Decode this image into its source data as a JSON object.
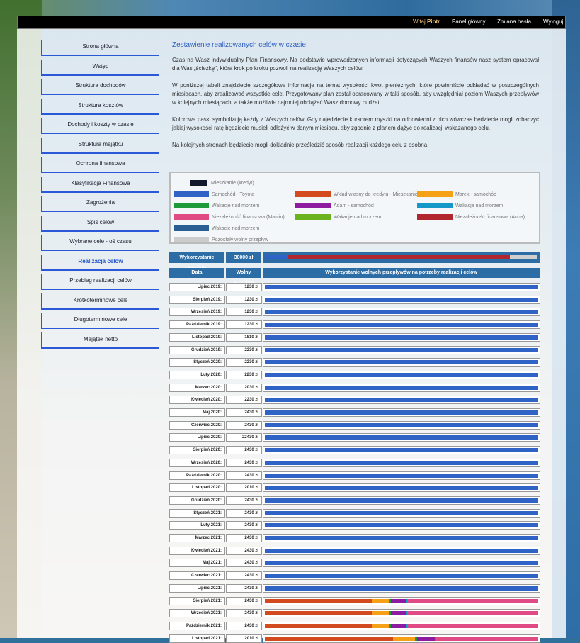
{
  "topbar": {
    "greeting_prefix": "Witaj",
    "user": "Piotr",
    "dashboard": "Panel główny",
    "change_password": "Zmiana hasła",
    "logout": "Wyloguj"
  },
  "sidebar": {
    "items": [
      {
        "label": "Strona główna",
        "active": false
      },
      {
        "label": "Wstęp",
        "active": false
      },
      {
        "label": "Struktura dochodów",
        "active": false
      },
      {
        "label": "Struktura kosztów",
        "active": false
      },
      {
        "label": "Dochody i koszty w czasie",
        "active": false
      },
      {
        "label": "Struktura majątku",
        "active": false
      },
      {
        "label": "Ochrona finansowa",
        "active": false
      },
      {
        "label": "Klasyfikacja Finansowa",
        "active": false
      },
      {
        "label": "Zagrożenia",
        "active": false
      },
      {
        "label": "Spis celów",
        "active": false
      },
      {
        "label": "Wybrane cele - oś czasu",
        "active": false
      },
      {
        "label": "Realizacja celów",
        "active": true
      },
      {
        "label": "Przebieg realizacji celów",
        "active": false
      },
      {
        "label": "Krótkoterminowe cele",
        "active": false
      },
      {
        "label": "Długoterminowe cele",
        "active": false
      },
      {
        "label": "Majątek netto",
        "active": false
      }
    ]
  },
  "main": {
    "heading": "Zestawienie realizowanych celów w czasie:",
    "paragraphs": [
      "Czas na Wasz indywidualny Plan Finansowy. Na podstawie wprowadzonych informacji dotyczących Waszych finansów nasz system opracował dla Was „ścieżkę\", która krok po kroku pozwoli na realizację Waszych celów.",
      "W poniższej tabeli znajdziecie szczegółowe informacje na temat wysokości kwot pieniężnych, które powinniście odkładać w poszczególnych miesiącach, aby zrealizować wszystkie cele. Przygotowany plan został opracowany w taki sposób, aby uwzględniał poziom Waszych przepływów w kolejnych miesiącach, a także możliwie najmniej obciążać Wasz domowy budżet.",
      "Kolorowe paski symbolizują każdy z Waszych celów. Gdy najedziecie kursorem myszki na odpowiedni z nich wówczas będziecie mogli zobaczyć jakiej wysokości ratę będziecie musieli odłożyć w danym miesiącu, aby zgodnie z planem dążyć do realizacji wskazanego celu.",
      "Na kolejnych stronach będziecie mogli dokładnie prześledzić sposób realizacji każdego celu z osobna."
    ]
  },
  "legend": [
    {
      "label": "Mieszkanie (kredyt)",
      "color": "#111a2a"
    },
    {
      "label": "Samochód - Toyota",
      "color": "#2f63c6"
    },
    {
      "label": "Wkład własny do kredytu - Mieszkanie",
      "color": "#d24a1e"
    },
    {
      "label": "Marek - samochód",
      "color": "#f5a015"
    },
    {
      "label": "Wakacje nad morzem",
      "color": "#1f9a3a"
    },
    {
      "label": "Adam - samochód",
      "color": "#8e1aa0"
    },
    {
      "label": "Wakacje nad morzem",
      "color": "#1598c8"
    },
    {
      "label": "Niezależność finansowa (Marcin)",
      "color": "#e04b86"
    },
    {
      "label": "Wakacje nad morzem",
      "color": "#6ab21e"
    },
    {
      "label": "Niezależność finansowa (Anna)",
      "color": "#b1252e"
    },
    {
      "label": "Wakacje nad morzem",
      "color": "#2b5e92"
    },
    {
      "label": "Pozostały wolny przepływ",
      "color": "#cccccc"
    }
  ],
  "deposit": {
    "label": "Wykorzystanie depozytu",
    "value": "30000 zł",
    "segments": [
      {
        "color": "#2f63c6",
        "share": 0.08
      },
      {
        "color": "#b1252e",
        "share": 0.82
      },
      {
        "color": "#cfcfcf",
        "share": 0.1
      }
    ]
  },
  "table": {
    "col_date": "Data",
    "col_free": "Wolny przepływ",
    "col_usage": "Wykorzystanie wolnych przepływów na potrzeby realizacji celów",
    "rows": [
      {
        "date": "Lipiec 2019:",
        "amount": "1230 zł",
        "segments": [
          {
            "color": "#2f63c6",
            "share": 1
          }
        ]
      },
      {
        "date": "Sierpień 2019:",
        "amount": "1230 zł",
        "segments": [
          {
            "color": "#2f63c6",
            "share": 1
          }
        ]
      },
      {
        "date": "Wrzesień 2019:",
        "amount": "1230 zł",
        "segments": [
          {
            "color": "#2f63c6",
            "share": 1
          }
        ]
      },
      {
        "date": "Październik 2019:",
        "amount": "1230 zł",
        "segments": [
          {
            "color": "#2f63c6",
            "share": 1
          }
        ]
      },
      {
        "date": "Listopad 2019:",
        "amount": "1810 zł",
        "segments": [
          {
            "color": "#2f63c6",
            "share": 1
          }
        ]
      },
      {
        "date": "Grudzień 2019:",
        "amount": "2230 zł",
        "segments": [
          {
            "color": "#2f63c6",
            "share": 1
          }
        ]
      },
      {
        "date": "Styczeń 2020:",
        "amount": "2230 zł",
        "segments": [
          {
            "color": "#2f63c6",
            "share": 1
          }
        ]
      },
      {
        "date": "Luty 2020:",
        "amount": "2230 zł",
        "segments": [
          {
            "color": "#2f63c6",
            "share": 1
          }
        ]
      },
      {
        "date": "Marzec 2020:",
        "amount": "2030 zł",
        "segments": [
          {
            "color": "#2f63c6",
            "share": 1
          }
        ]
      },
      {
        "date": "Kwiecień 2020:",
        "amount": "2230 zł",
        "segments": [
          {
            "color": "#2f63c6",
            "share": 1
          }
        ]
      },
      {
        "date": "Maj 2020:",
        "amount": "2430 zł",
        "segments": [
          {
            "color": "#2f63c6",
            "share": 1
          }
        ]
      },
      {
        "date": "Czerwiec 2020:",
        "amount": "2430 zł",
        "segments": [
          {
            "color": "#2f63c6",
            "share": 1
          }
        ]
      },
      {
        "date": "Lipiec 2020:",
        "amount": "22430 zł",
        "segments": [
          {
            "color": "#2f63c6",
            "share": 1
          }
        ]
      },
      {
        "date": "Sierpień 2020:",
        "amount": "2430 zł",
        "segments": [
          {
            "color": "#2f63c6",
            "share": 1
          }
        ]
      },
      {
        "date": "Wrzesień 2020:",
        "amount": "2430 zł",
        "segments": [
          {
            "color": "#2f63c6",
            "share": 1
          }
        ]
      },
      {
        "date": "Październik 2020:",
        "amount": "2430 zł",
        "segments": [
          {
            "color": "#2f63c6",
            "share": 1
          }
        ]
      },
      {
        "date": "Listopad 2020:",
        "amount": "2010 zł",
        "segments": [
          {
            "color": "#2f63c6",
            "share": 1
          }
        ]
      },
      {
        "date": "Grudzień 2020:",
        "amount": "2430 zł",
        "segments": [
          {
            "color": "#2f63c6",
            "share": 1
          }
        ]
      },
      {
        "date": "Styczeń 2021:",
        "amount": "2430 zł",
        "segments": [
          {
            "color": "#2f63c6",
            "share": 1
          }
        ]
      },
      {
        "date": "Luty 2021:",
        "amount": "2430 zł",
        "segments": [
          {
            "color": "#2f63c6",
            "share": 1
          }
        ]
      },
      {
        "date": "Marzec 2021:",
        "amount": "2430 zł",
        "segments": [
          {
            "color": "#2f63c6",
            "share": 1
          }
        ]
      },
      {
        "date": "Kwiecień 2021:",
        "amount": "2430 zł",
        "segments": [
          {
            "color": "#2f63c6",
            "share": 1
          }
        ]
      },
      {
        "date": "Maj 2021:",
        "amount": "2430 zł",
        "segments": [
          {
            "color": "#2f63c6",
            "share": 1
          }
        ]
      },
      {
        "date": "Czerwiec 2021:",
        "amount": "2430 zł",
        "segments": [
          {
            "color": "#2f63c6",
            "share": 1
          }
        ]
      },
      {
        "date": "Lipiec 2021:",
        "amount": "2430 zł",
        "segments": [
          {
            "color": "#2f63c6",
            "share": 1
          }
        ]
      },
      {
        "date": "Sierpień 2021:",
        "amount": "2430 zł",
        "segments": [
          {
            "color": "#d24a1e",
            "share": 0.39
          },
          {
            "color": "#f5a015",
            "share": 0.065
          },
          {
            "color": "#1f9a3a",
            "share": 0.006
          },
          {
            "color": "#8e1aa0",
            "share": 0.055
          },
          {
            "color": "#1598c8",
            "share": 0.006
          },
          {
            "color": "#e04b86",
            "share": 0.478
          }
        ]
      },
      {
        "date": "Wrzesień 2021:",
        "amount": "2430 zł",
        "segments": [
          {
            "color": "#d24a1e",
            "share": 0.39
          },
          {
            "color": "#f5a015",
            "share": 0.065
          },
          {
            "color": "#1f9a3a",
            "share": 0.006
          },
          {
            "color": "#8e1aa0",
            "share": 0.055
          },
          {
            "color": "#1598c8",
            "share": 0.006
          },
          {
            "color": "#e04b86",
            "share": 0.478
          }
        ]
      },
      {
        "date": "Październik 2021:",
        "amount": "2430 zł",
        "segments": [
          {
            "color": "#d24a1e",
            "share": 0.39
          },
          {
            "color": "#f5a015",
            "share": 0.065
          },
          {
            "color": "#1f9a3a",
            "share": 0.006
          },
          {
            "color": "#8e1aa0",
            "share": 0.055
          },
          {
            "color": "#1598c8",
            "share": 0.006
          },
          {
            "color": "#e04b86",
            "share": 0.478
          }
        ]
      },
      {
        "date": "Listopad 2021:",
        "amount": "2010 zł",
        "segments": [
          {
            "color": "#d24a1e",
            "share": 0.47
          },
          {
            "color": "#f5a015",
            "share": 0.08
          },
          {
            "color": "#1f9a3a",
            "share": 0.006
          },
          {
            "color": "#8e1aa0",
            "share": 0.065
          },
          {
            "color": "#1598c8",
            "share": 0.006
          },
          {
            "color": "#e04b86",
            "share": 0.373
          }
        ]
      }
    ]
  }
}
